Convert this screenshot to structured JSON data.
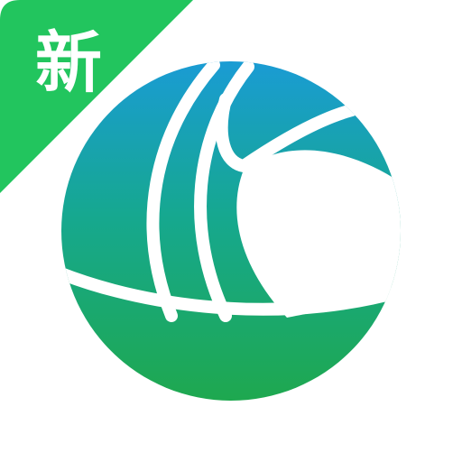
{
  "app_icon": {
    "icon": "sailboat-logo-icon",
    "badge": {
      "label": "新",
      "color": "#22c55e"
    },
    "colors": {
      "background": "#ffffff",
      "gradient_top": "#1a9bd7",
      "gradient_mid": "#16a88f",
      "gradient_bottom": "#1fa84a"
    }
  }
}
